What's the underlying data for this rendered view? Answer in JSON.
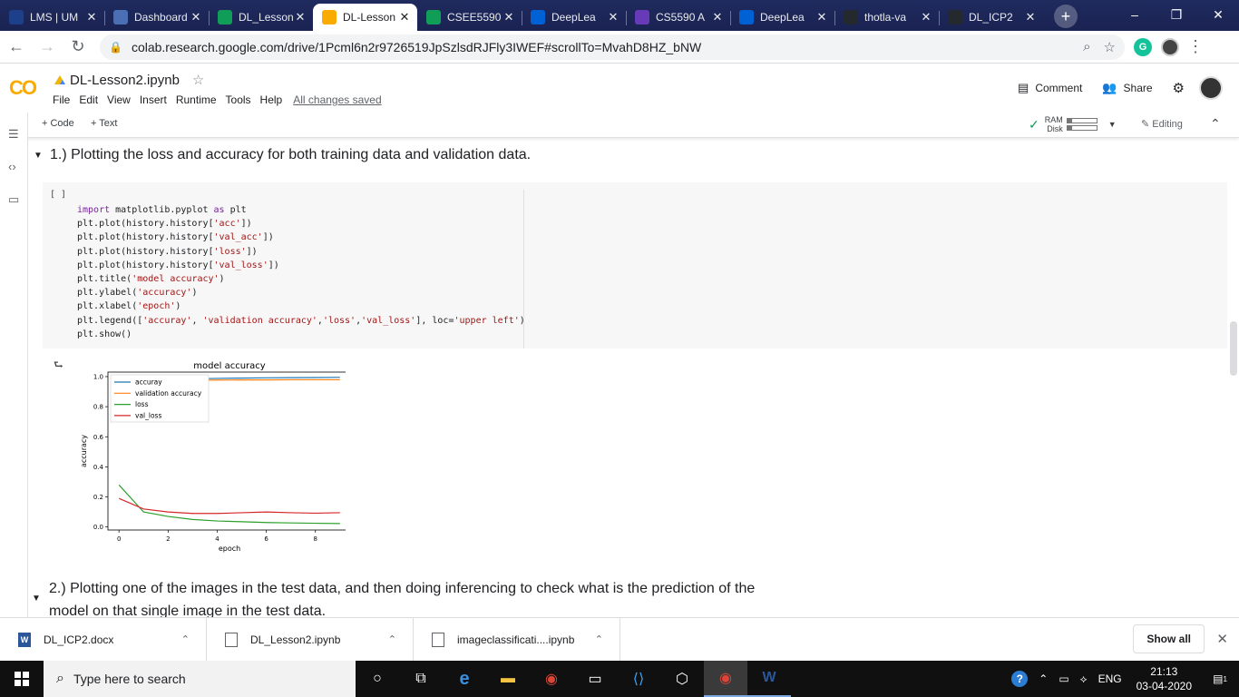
{
  "browser": {
    "tabs": [
      {
        "title": "LMS | UM",
        "icon": "lms-icon",
        "color": "#1e3f8a"
      },
      {
        "title": "Dashboard",
        "icon": "dashboard-icon",
        "color": "#4a6fb5"
      },
      {
        "title": "DL_Lesson",
        "icon": "google-drive-icon",
        "color": "#0f9d58"
      },
      {
        "title": "DL-Lesson",
        "icon": "colab-icon",
        "color": "#f9ab00",
        "active": true
      },
      {
        "title": "CSEE5590",
        "icon": "sheets-icon",
        "color": "#0f9d58"
      },
      {
        "title": "DeepLea",
        "icon": "box-icon",
        "color": "#0061d5"
      },
      {
        "title": "CS5590 A",
        "icon": "forms-icon",
        "color": "#673ab7"
      },
      {
        "title": "DeepLea",
        "icon": "box-icon",
        "color": "#0061d5"
      },
      {
        "title": "thotla-va",
        "icon": "github-icon",
        "color": "#24292e"
      },
      {
        "title": "DL_ICP2",
        "icon": "github-icon",
        "color": "#24292e"
      }
    ],
    "new_tab": "+",
    "window_controls": {
      "minimize": "–",
      "restore": "❐",
      "close": "✕"
    },
    "url": "colab.research.google.com/drive/1Pcml6n2r9726519JpSzlsdRJFly3IWEF#scrollTo=MvahD8HZ_bNW",
    "extension_g": "G"
  },
  "colab": {
    "logo": "CO",
    "notebook_title": "DL-Lesson2.ipynb",
    "menu": [
      "File",
      "Edit",
      "View",
      "Insert",
      "Runtime",
      "Tools",
      "Help"
    ],
    "save_status": "All changes saved",
    "comment_label": "Comment",
    "share_label": "Share",
    "add_code": "+ Code",
    "add_text": "+ Text",
    "ram_label": "RAM",
    "disk_label": "Disk",
    "editing_label": "Editing"
  },
  "notebook": {
    "heading1": "1.) Plotting the loss and accuracy for both training data and validation data.",
    "run_indicator": "[ ]",
    "heading2": "2.) Plotting one of the images in the test data, and then doing inferencing to check what is the prediction of the model on that single image in the test data."
  },
  "chart_data": {
    "type": "line",
    "title": "model accuracy",
    "xlabel": "epoch",
    "ylabel": "accuracy",
    "xlim": [
      -0.45,
      9.45
    ],
    "ylim": [
      -0.02,
      1.03
    ],
    "xticks": [
      0,
      2,
      4,
      6,
      8
    ],
    "yticks": [
      0.0,
      0.2,
      0.4,
      0.6,
      0.8,
      1.0
    ],
    "legend_position": "upper left",
    "x": [
      0,
      1,
      2,
      3,
      4,
      5,
      6,
      7,
      8,
      9
    ],
    "series": [
      {
        "name": "accuray",
        "color": "#1f77b4",
        "values": [
          0.94,
          0.97,
          0.98,
          0.985,
          0.988,
          0.99,
          0.992,
          0.993,
          0.994,
          0.995
        ]
      },
      {
        "name": "validation accuracy",
        "color": "#ff7f0e",
        "values": [
          0.975,
          0.976,
          0.977,
          0.976,
          0.977,
          0.978,
          0.978,
          0.979,
          0.979,
          0.979
        ]
      },
      {
        "name": "loss",
        "color": "#2ca02c",
        "values": [
          0.28,
          0.1,
          0.07,
          0.05,
          0.04,
          0.035,
          0.03,
          0.027,
          0.025,
          0.023
        ]
      },
      {
        "name": "val_loss",
        "color": "#d62728",
        "values": [
          0.19,
          0.12,
          0.1,
          0.09,
          0.09,
          0.095,
          0.1,
          0.095,
          0.092,
          0.095
        ]
      }
    ]
  },
  "downloads": {
    "items": [
      {
        "name": "DL_ICP2.docx",
        "icon": "word-doc-icon"
      },
      {
        "name": "DL_Lesson2.ipynb",
        "icon": "file-icon"
      },
      {
        "name": "imageclassificati....ipynb",
        "icon": "file-icon"
      }
    ],
    "show_all": "Show all"
  },
  "taskbar": {
    "search_placeholder": "Type here to search",
    "language": "ENG",
    "time": "21:13",
    "date": "03-04-2020",
    "notification_count": "1"
  }
}
